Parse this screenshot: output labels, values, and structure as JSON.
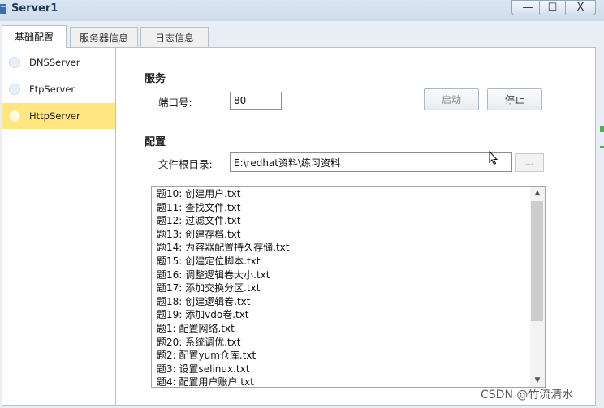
{
  "window": {
    "title": "Server1",
    "controls": {
      "minimize": "—",
      "maximize": "☐",
      "close": "X"
    }
  },
  "tabs": [
    {
      "label": "基础配置",
      "active": true
    },
    {
      "label": "服务器信息",
      "active": false
    },
    {
      "label": "日志信息",
      "active": false
    }
  ],
  "sidebar": {
    "items": [
      {
        "label": "DNSServer",
        "selected": false
      },
      {
        "label": "FtpServer",
        "selected": false
      },
      {
        "label": "HttpServer",
        "selected": true
      }
    ]
  },
  "service": {
    "section_title": "服务",
    "port_label": "端口号:",
    "port_value": "80",
    "start_label": "启动",
    "stop_label": "停止"
  },
  "config": {
    "section_title": "配置",
    "root_label": "文件根目录:",
    "root_value": "E:\\redhat资料\\练习资料",
    "browse_label": "..."
  },
  "files": [
    "题10: 创建用户.txt",
    "题11: 查找文件.txt",
    "题12: 过滤文件.txt",
    "题13: 创建存档.txt",
    "题14: 为容器配置持久存储.txt",
    "题15: 创建定位脚本.txt",
    "题16: 调整逻辑卷大小.txt",
    "题17: 添加交换分区.txt",
    "题18: 创建逻辑卷.txt",
    "题19: 添加vdo卷.txt",
    "题1: 配置网络.txt",
    "题20: 系统调优.txt",
    "题2: 配置yum仓库.txt",
    "题3: 设置selinux.txt",
    "题4: 配置用户账户.txt"
  ],
  "scroll": {
    "up": "▲",
    "down": "▼"
  },
  "watermark": "CSDN @竹流清水",
  "colors": {
    "selected_item": "#ffe680",
    "titlebar": "#dbe6f4",
    "panel_border": "#b7c1cc"
  }
}
